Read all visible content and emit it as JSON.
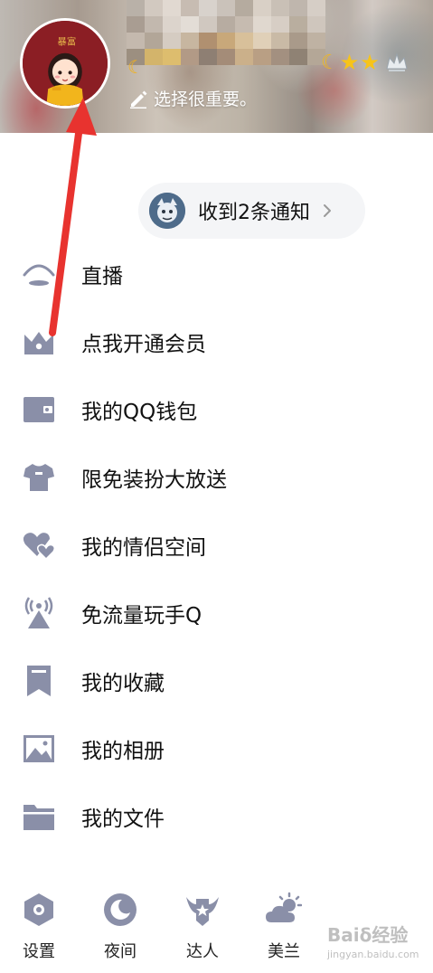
{
  "profile": {
    "signature": "选择很重要。",
    "level_icons": [
      "moon",
      "moon",
      "star",
      "star",
      "crown"
    ]
  },
  "notification": {
    "text": "收到2条通知"
  },
  "menu": {
    "items": [
      {
        "label": "直播",
        "icon": "live-icon"
      },
      {
        "label": "点我开通会员",
        "icon": "vip-crown-icon"
      },
      {
        "label": "我的QQ钱包",
        "icon": "wallet-icon"
      },
      {
        "label": "限免装扮大放送",
        "icon": "tshirt-icon"
      },
      {
        "label": "我的情侣空间",
        "icon": "hearts-icon"
      },
      {
        "label": "免流量玩手Q",
        "icon": "signal-tower-icon"
      },
      {
        "label": "我的收藏",
        "icon": "bookmark-icon"
      },
      {
        "label": "我的相册",
        "icon": "photo-icon"
      },
      {
        "label": "我的文件",
        "icon": "folder-icon"
      }
    ]
  },
  "bottom_bar": {
    "items": [
      {
        "label": "设置",
        "icon": "settings-icon"
      },
      {
        "label": "夜间",
        "icon": "night-mode-icon"
      },
      {
        "label": "达人",
        "icon": "talent-icon"
      },
      {
        "label": "美兰",
        "icon": "weather-icon"
      }
    ]
  },
  "watermark": {
    "main": "Baiδ经验",
    "sub": "jingyan.baidu.com"
  },
  "colors": {
    "icon_gray": "#8a8fa8",
    "annotation_red": "#e8332f",
    "star_gold": "#f7c419",
    "pill_bg": "#f4f5f7"
  }
}
